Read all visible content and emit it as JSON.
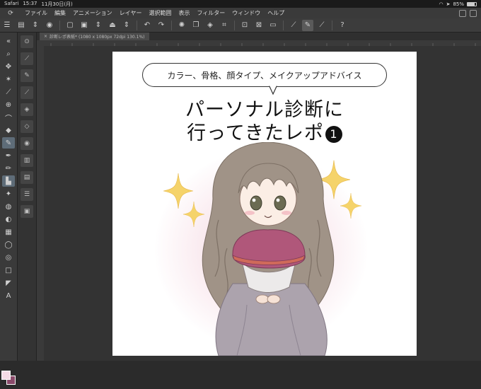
{
  "status_bar": {
    "browser": "Safari",
    "time": "15:37",
    "date": "11月30日(月)",
    "battery": "85%",
    "battery_level": 0.85
  },
  "menu": {
    "items": [
      "ファイル",
      "編集",
      "アニメーション",
      "レイヤー",
      "選択範囲",
      "表示",
      "フィルター",
      "ウィンドウ",
      "ヘルプ"
    ]
  },
  "document": {
    "tab_title": "診断レポ表紙* (1080 x 1080px 72dpi 130.1%)"
  },
  "artwork": {
    "speech_text": "カラー、骨格、顔タイプ、メイクアップアドバイス",
    "title_line1": "パーソナル診断に",
    "title_line2": "行ってきたレポ",
    "badge_number": "1"
  },
  "colors": {
    "main_color": "#f4dbe6",
    "sub_color": "#8a4a6a",
    "glow": "#f0bed2",
    "sparkle": "#f5d36a",
    "hair": "#a09387",
    "cape": "#b0577a",
    "dress": "#aca3ad"
  }
}
